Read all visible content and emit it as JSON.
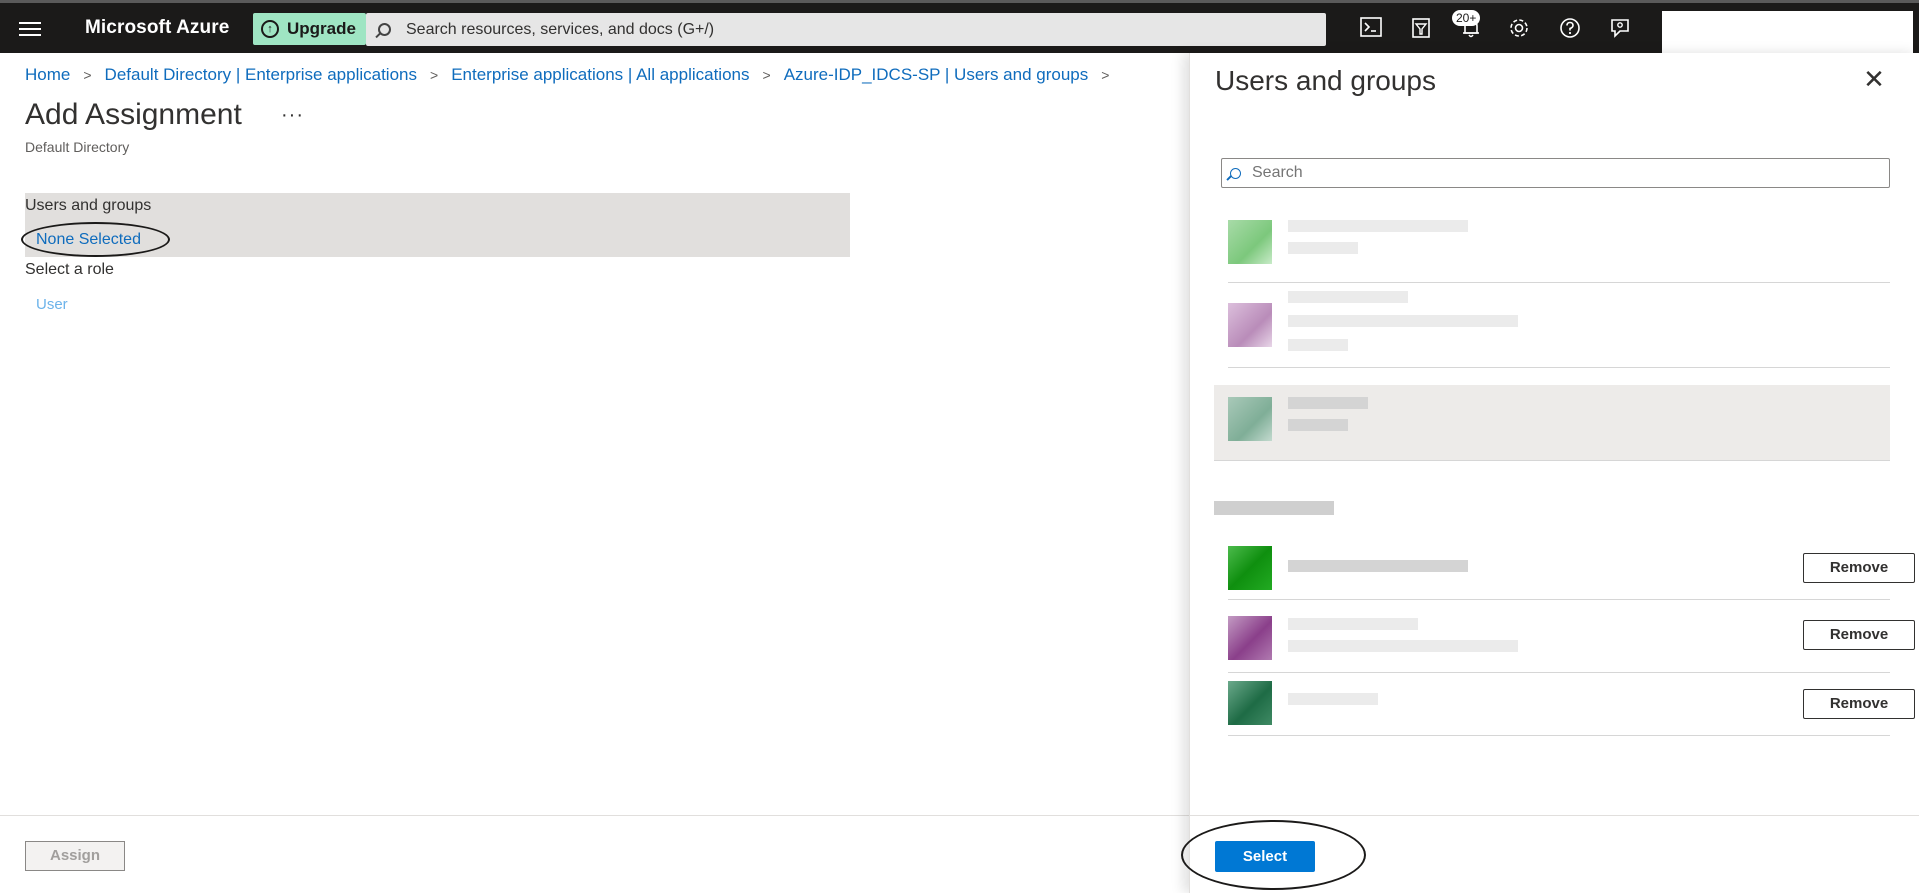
{
  "topbar": {
    "brand": "Microsoft Azure",
    "upgrade_label": "Upgrade",
    "search_placeholder": "Search resources, services, and docs (G+/)",
    "notification_badge": "20+",
    "icons": [
      "cloud-shell-icon",
      "directory-filter-icon",
      "notifications-icon",
      "settings-icon",
      "help-icon",
      "feedback-icon"
    ]
  },
  "breadcrumb": {
    "items": [
      "Home",
      "Default Directory | Enterprise applications",
      "Enterprise applications | All applications",
      "Azure-IDP_IDCS-SP | Users and groups"
    ]
  },
  "page": {
    "title": "Add Assignment",
    "more": "···",
    "subtitle": "Default Directory",
    "users_groups_label": "Users and groups",
    "users_groups_value": "None Selected",
    "role_label": "Select a role",
    "role_value": "User",
    "assign_label": "Assign"
  },
  "panel": {
    "title": "Users and groups",
    "close": "✕",
    "search_placeholder": "Search",
    "remove_label": "Remove",
    "select_label": "Select"
  },
  "colors": {
    "topbar_bg": "#1b1a19",
    "upgrade_bg": "#9fe5c3",
    "link": "#0f6cbd",
    "primary": "#0078d4"
  }
}
